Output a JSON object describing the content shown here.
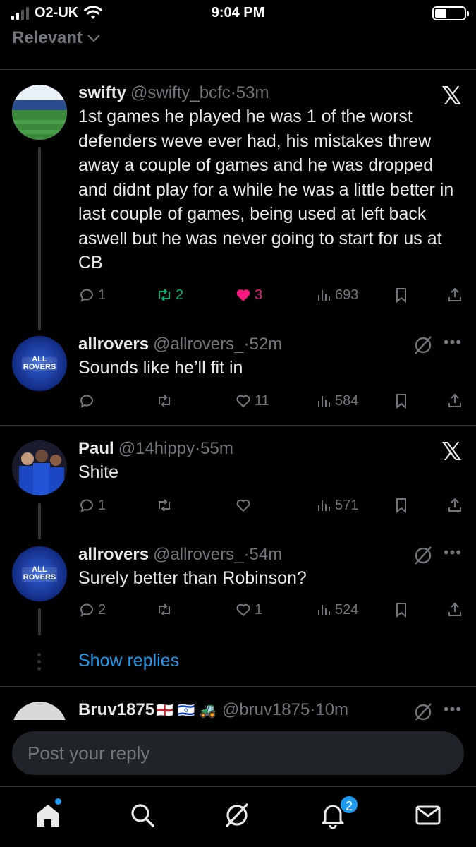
{
  "status": {
    "carrier": "O2-UK",
    "time": "9:04 PM",
    "battery_level": 0.4
  },
  "sort": {
    "label": "Relevant"
  },
  "posts": [
    {
      "name": "swifty",
      "handle": "@swifty_bcfc",
      "time": "53m",
      "text": "1st games he played he was 1 of the worst defenders weve ever had, his mistakes threw away a couple of games and he was dropped and didnt play for a while he was a little better in last couple of games, being used at left back aswell but he was never going to start for us at CB",
      "replies": "1",
      "reposts": "2",
      "likes": "3",
      "views": "693"
    },
    {
      "name": "allrovers",
      "handle": "@allrovers_",
      "time": "52m",
      "text": "Sounds like he’ll fit in",
      "avatar_text": [
        "ALL",
        "ROVERS"
      ],
      "replies": "",
      "reposts": "",
      "likes": "11",
      "views": "584"
    },
    {
      "name": "Paul",
      "handle": "@14hippy",
      "time": "55m",
      "text": "Shite",
      "replies": "1",
      "reposts": "",
      "likes": "",
      "views": "571"
    },
    {
      "name": "allrovers",
      "handle": "@allrovers_",
      "time": "54m",
      "text": "Surely better than Robinson?",
      "avatar_text": [
        "ALL",
        "ROVERS"
      ],
      "replies": "2",
      "reposts": "",
      "likes": "1",
      "views": "524"
    },
    {
      "name": "Bruv1875",
      "name_emoji": "🏴󠁧󠁢󠁥󠁮󠁧󠁿 🇮🇱 🚜",
      "handle": "@bruv1875",
      "time": "10m"
    }
  ],
  "show_replies": "Show replies",
  "reply_placeholder": "Post your reply",
  "tabbar": {
    "notifications_badge": "2"
  },
  "colors": {
    "accent": "#1d9bf0",
    "like": "#f91880",
    "repost": "#00ba7c",
    "muted": "#71767b"
  }
}
